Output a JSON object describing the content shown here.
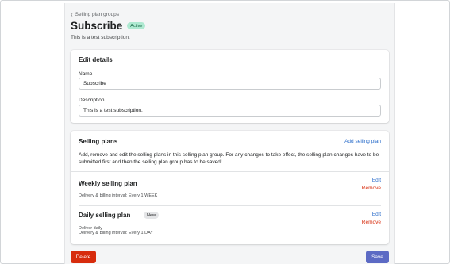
{
  "breadcrumb": {
    "icon": "chevron-left-icon",
    "label": "Selling plan groups"
  },
  "page": {
    "title": "Subscribe",
    "status_badge": "Active",
    "subtitle": "This is a test subscription."
  },
  "edit_details": {
    "title": "Edit details",
    "name_label": "Name",
    "name_value": "Subscribe",
    "description_label": "Description",
    "description_value": "This is a test subscription."
  },
  "selling_plans": {
    "title": "Selling plans",
    "add_label": "Add selling plan",
    "description": "Add, remove and edit the selling plans in this selling plan group. For any changes to take effect, the selling plan changes have to be submitted first and then the selling plan group has to be saved!",
    "plans": [
      {
        "name": "Weekly selling plan",
        "details": [
          "Delivery & billing interval: Every 1 WEEK"
        ],
        "edit_label": "Edit",
        "remove_label": "Remove"
      },
      {
        "name": "Daily selling plan",
        "badge": "New",
        "details": [
          "Deliver daily",
          "Delivery & billing interval: Every 1 DAY"
        ],
        "edit_label": "Edit",
        "remove_label": "Remove"
      }
    ]
  },
  "actions": {
    "delete_label": "Delete",
    "save_label": "Save"
  },
  "colors": {
    "accent": "#5c6ac4",
    "danger": "#d72c0d",
    "link": "#2c6ecb",
    "active_badge_bg": "#aee9d1",
    "background": "#f4f5f6"
  }
}
